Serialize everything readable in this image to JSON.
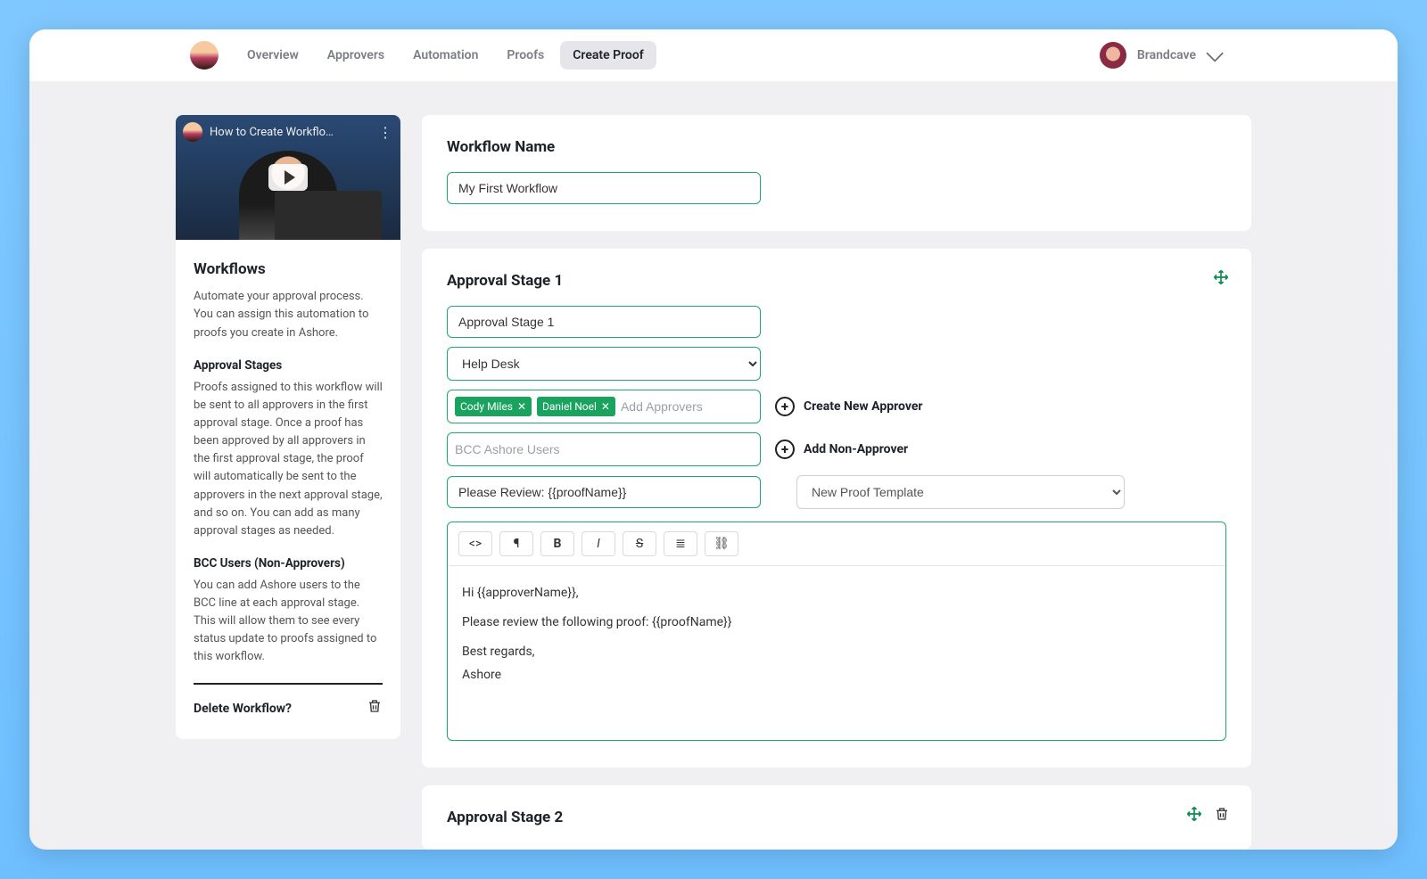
{
  "nav": {
    "tabs": [
      "Overview",
      "Approvers",
      "Automation",
      "Proofs",
      "Create Proof"
    ],
    "active_index": 4,
    "org_name": "Brandcave"
  },
  "sidebar": {
    "video_title": "How to Create Workflo…",
    "heading": "Workflows",
    "intro": "Automate your approval process. You can assign this automation to proofs you create in Ashore.",
    "section1_title": "Approval Stages",
    "section1_body": "Proofs assigned to this workflow will be sent to all approvers in the first approval stage. Once a proof has been approved by all approvers in the first approval stage, the proof will automatically be sent to the approvers in the next approval stage, and so on. You can add as many approval stages as needed.",
    "section2_title": "BCC Users (Non-Approvers)",
    "section2_body": "You can add Ashore users to the BCC line at each approval stage. This will allow them to see every status update to proofs assigned to this workflow.",
    "delete_label": "Delete Workflow?"
  },
  "workflow": {
    "name_label": "Workflow Name",
    "name_value": "My First Workflow"
  },
  "stage1": {
    "heading": "Approval Stage 1",
    "name_value": "Approval Stage 1",
    "mailbox_value": "Help Desk",
    "approvers": [
      "Cody Miles",
      "Daniel Noel"
    ],
    "approvers_placeholder": "Add Approvers",
    "create_approver_label": "Create New Approver",
    "bcc_placeholder": "BCC Ashore Users",
    "add_non_approver_label": "Add Non-Approver",
    "subject_value": "Please Review: {{proofName}}",
    "template_value": "New Proof Template",
    "message_lines": [
      "Hi {{approverName}},",
      "Please review the following proof: {{proofName}}",
      "Best regards,",
      "Ashore"
    ]
  },
  "stage2": {
    "heading": "Approval Stage 2"
  },
  "toolbar_icons": {
    "code": "<>",
    "paragraph": "¶",
    "bold": "B",
    "italic": "I",
    "strike": "S",
    "list": "≣",
    "link": "⛓"
  }
}
